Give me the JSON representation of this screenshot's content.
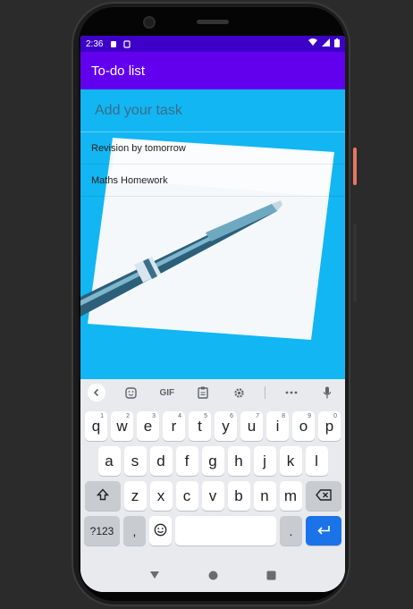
{
  "status_bar": {
    "time": "2:36"
  },
  "app_bar": {
    "title": "To-do list"
  },
  "task_input": {
    "placeholder": "Add your task"
  },
  "tasks": [
    {
      "label": "Revision by tomorrow"
    },
    {
      "label": "Maths Homework"
    }
  ],
  "keyboard": {
    "toolbar": {
      "gif_label": "GIF"
    },
    "row1": [
      {
        "key": "q",
        "hint": "1"
      },
      {
        "key": "w",
        "hint": "2"
      },
      {
        "key": "e",
        "hint": "3"
      },
      {
        "key": "r",
        "hint": "4"
      },
      {
        "key": "t",
        "hint": "5"
      },
      {
        "key": "y",
        "hint": "6"
      },
      {
        "key": "u",
        "hint": "7"
      },
      {
        "key": "i",
        "hint": "8"
      },
      {
        "key": "o",
        "hint": "9"
      },
      {
        "key": "p",
        "hint": "0"
      }
    ],
    "row2": [
      "a",
      "s",
      "d",
      "f",
      "g",
      "h",
      "j",
      "k",
      "l"
    ],
    "row3": [
      "z",
      "x",
      "c",
      "v",
      "b",
      "n",
      "m"
    ],
    "symbols_label": "?123",
    "comma_label": ",",
    "period_label": "."
  },
  "colors": {
    "status_bar": "#3e00c8",
    "app_bar": "#6200ee",
    "content_bg": "#12b6f2",
    "enter_key": "#1a73e8",
    "keyboard_bg": "#e8eaed"
  }
}
